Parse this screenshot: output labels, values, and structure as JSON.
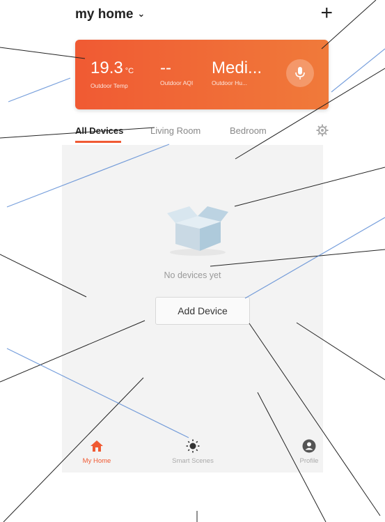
{
  "header": {
    "home_name": "my home",
    "chevron_icon": "chevron-down-icon",
    "add_icon": "plus-icon"
  },
  "weather": {
    "temp_value": "19.3",
    "temp_unit": "°C",
    "temp_label": "Outdoor Temp",
    "aqi_value": "--",
    "aqi_label": "Outdoor AQI",
    "humidity_value": "Medi...",
    "humidity_label": "Outdoor Hu...",
    "mic_icon": "microphone-icon"
  },
  "tabs": [
    {
      "label": "All Devices",
      "active": true
    },
    {
      "label": "Living Room",
      "active": false
    },
    {
      "label": "Bedroom",
      "active": false
    }
  ],
  "settings_icon": "gear-icon",
  "empty_state": {
    "text": "No devices yet",
    "icon": "empty-box-icon",
    "button": "Add Device"
  },
  "bottom_nav": [
    {
      "label": "My Home",
      "icon": "home-icon",
      "active": true
    },
    {
      "label": "Smart Scenes",
      "icon": "sun-icon",
      "active": false
    },
    {
      "label": "Profile",
      "icon": "profile-icon",
      "active": false
    }
  ],
  "colors": {
    "accent": "#f05a33",
    "background": "#f3f3f3",
    "callout_line": "#222222",
    "blue_line": "#4a7fd0"
  }
}
